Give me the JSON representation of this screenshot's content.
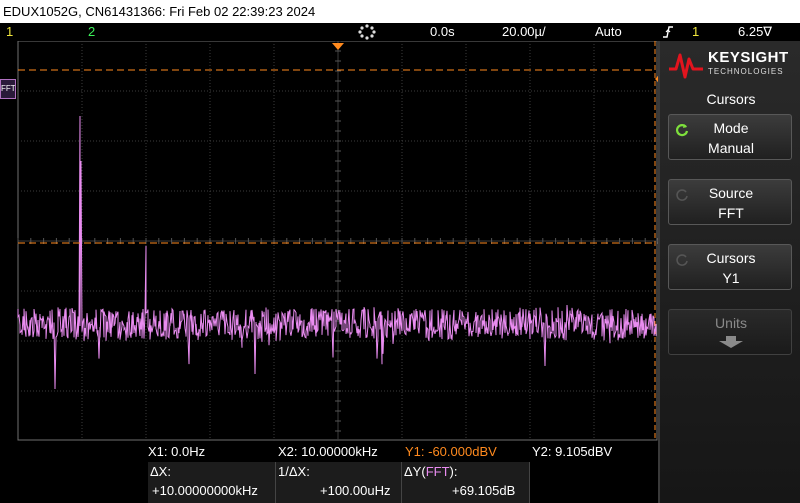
{
  "titlebar": {
    "text": "EDUX1052G, CN61431366: Fri Feb 02 22:39:23 2024"
  },
  "status": {
    "ch1": "1",
    "ch2": "2",
    "time_offset": "0.0s",
    "time_scale": "20.00µ/",
    "trigger_mode": "Auto",
    "trigger_source": "1",
    "trigger_level": "6.25∇",
    "trigger_icon": "rising-edge-icon"
  },
  "screen": {
    "fft_label": "FFT",
    "trace_color": "#e98cf0",
    "cursor_color": "#ff8a1e",
    "grid_divisions": {
      "x": 10,
      "y": 8
    },
    "grid": true
  },
  "chart_data": {
    "type": "line",
    "title": "",
    "series": [
      {
        "values": []
      }
    ],
    "xlim": [
      0,
      100
    ],
    "notes": ""
  },
  "sidepanel": {
    "brand": "KEYSIGHT",
    "brand_sub": "TECHNOLOGIES",
    "menu_title": "Cursors",
    "softkeys": [
      {
        "label": "Mode",
        "value": "Manual",
        "enabled": true
      },
      {
        "label": "Source",
        "value": "FFT",
        "enabled": true
      },
      {
        "label": "Cursors",
        "value": "Y1",
        "enabled": true
      },
      {
        "label": "Units",
        "value": "",
        "enabled": false
      }
    ]
  },
  "readouts": {
    "x1": "X1:  0.0Hz",
    "x2": "X2:  10.00000kHz",
    "y1": "Y1: -60.000dBV",
    "y2": "Y2:  9.105dBV",
    "dx_label": "ΔX:",
    "dx_value": "+10.00000000kHz",
    "inv_dx_label": "1/ΔX:",
    "inv_dx_value": "+100.00uHz",
    "dy_label": "ΔY(",
    "dy_source": "FFT",
    "dy_label_end": "):",
    "dy_value": "+69.105dB"
  }
}
